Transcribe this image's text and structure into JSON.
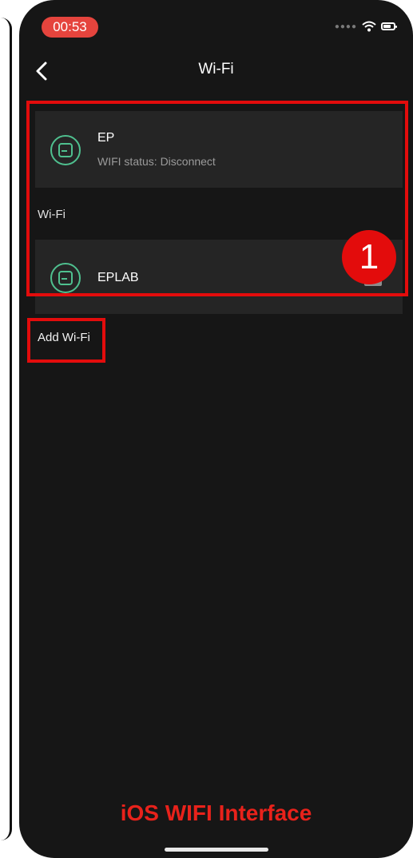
{
  "status_bar": {
    "time": "00:53",
    "signal_icon": "dots-signal-icon",
    "wifi_icon": "wifi-icon",
    "battery_icon": "battery-icon"
  },
  "nav": {
    "title": "Wi-Fi",
    "back_icon": "chevron-left-icon"
  },
  "current_network": {
    "name": "EP",
    "status": "WIFI status: Disconnect",
    "icon": "router-icon"
  },
  "section": {
    "label": "Wi-Fi"
  },
  "networks": [
    {
      "name": "EPLAB",
      "icon": "router-icon"
    }
  ],
  "add_wifi": {
    "label": "Add Wi-Fi"
  },
  "annotations": {
    "badge": "1",
    "caption": "iOS WIFI Interface",
    "color": "#e30c0c"
  },
  "colors": {
    "background": "#161616",
    "card": "#252525",
    "icon_accent": "#4fc08f",
    "time_pill": "#e5443d"
  }
}
